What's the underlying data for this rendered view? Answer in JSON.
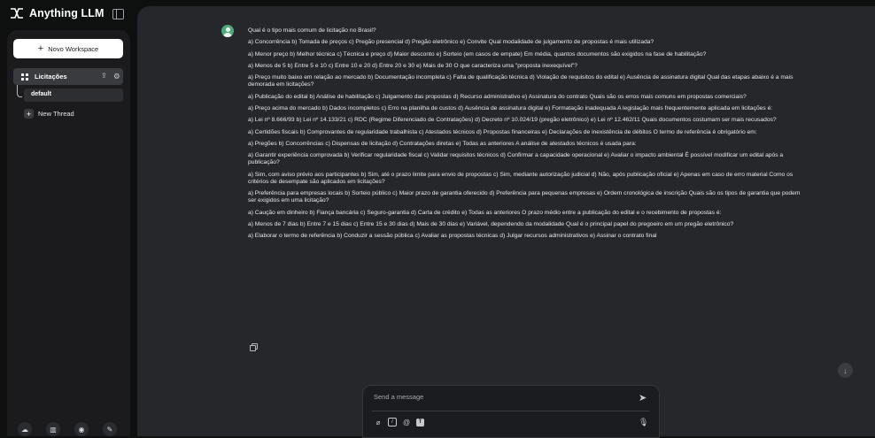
{
  "app": {
    "name": "Anything LLM"
  },
  "sidebar": {
    "new_workspace_label": "Novo Workspace",
    "workspace": {
      "label": "Licitações",
      "threads": [
        {
          "label": "default"
        }
      ]
    },
    "new_thread_label": "New Thread",
    "footer_icons": [
      "community-hub-icon",
      "docs-book-icon",
      "discord-icon",
      "settings-wrench-icon"
    ]
  },
  "chat": {
    "paragraphs": [
      "Qual é o tipo mais comum de licitação no Brasil?",
      "a) Concorrência b) Tomada de preços c) Pregão presencial d) Pregão eletrônico e) Convite Qual modalidade de julgamento de propostas é mais utilizada?",
      "a) Menor preço b) Melhor técnica c) Técnica e preço d) Maior desconto e) Sorteio (em casos de empate) Em média, quantos documentos são exigidos na fase de habilitação?",
      "a) Menos de 5 b) Entre 5 e 10 c) Entre 10 e 20 d) Entre 20 e 30 e) Mais de 30 O que caracteriza uma \"proposta inexequível\"?",
      "a) Preço muito baixo em relação ao mercado b) Documentação incompleta c) Falta de qualificação técnica d) Violação de requisitos do edital e) Ausência de assinatura digital Qual das etapas abaixo é a mais demorada em licitações?",
      "a) Publicação do edital b) Análise de habilitação c) Julgamento das propostas d) Recurso administrativo e) Assinatura do contrato Quais são os erros mais comuns em propostas comerciais?",
      "a) Preço acima do mercado b) Dados incompletos c) Erro na planilha de custos d) Ausência de assinatura digital e) Formatação inadequada A legislação mais frequentemente aplicada em licitações é:",
      "a) Lei nº 8.666/93 b) Lei nº 14.133/21 c) RDC (Regime Diferenciado de Contratações) d) Decreto nº 10.024/19 (pregão eletrônico) e) Lei nº 12.462/11 Quais documentos costumam ser mais recusados?",
      "a) Certidões fiscais b) Comprovantes de regularidade trabalhista c) Atestados técnicos d) Propostas financeiras e) Declarações de inexistência de débitos O termo de referência é obrigatório em:",
      "a) Pregões b) Concorrências c) Dispensas de licitação d) Contratações diretas e) Todas as anteriores A análise de atestados técnicos é usada para:",
      "a) Garantir experiência comprovada b) Verificar regularidade fiscal c) Validar requisitos técnicos d) Confirmar a capacidade operacional e) Avaliar o impacto ambiental É possível modificar um edital após a publicação?",
      "a) Sim, com aviso prévio aos participantes b) Sim, até o prazo limite para envio de propostas c) Sim, mediante autorização judicial d) Não, após publicação oficial e) Apenas em caso de erro material Como os critérios de desempate são aplicados em licitações?",
      "a) Preferência para empresas locais b) Sorteio público c) Maior prazo de garantia oferecido d) Preferência para pequenas empresas e) Ordem cronológica de inscrição Quais são os tipos de garantia que podem ser exigidos em uma licitação?",
      "a) Caução em dinheiro b) Fiança bancária c) Seguro-garantia d) Carta de crédito e) Todas as anteriores O prazo médio entre a publicação do edital e o recebimento de propostas é:",
      "a) Menos de 7 dias b) Entre 7 e 15 dias c) Entre 15 e 30 dias d) Mais de 30 dias e) Variável, dependendo da modalidade Qual é o principal papel do pregoeiro em um pregão eletrônico?",
      "a) Elaborar o termo de referência b) Conduzir a sessão pública c) Avaliar as propostas técnicas d) Julgar recursos administrativos e) Assinar o contrato final"
    ]
  },
  "composer": {
    "placeholder": "Send a message",
    "tools": [
      "attach-icon",
      "slash-command-icon",
      "mention-icon",
      "text-format-icon"
    ]
  },
  "colors": {
    "sidebar_bg": "#0e0f0f",
    "panel_bg": "#1b1b1e",
    "main_bg": "#25272b",
    "avatar": "#4ea87a"
  }
}
